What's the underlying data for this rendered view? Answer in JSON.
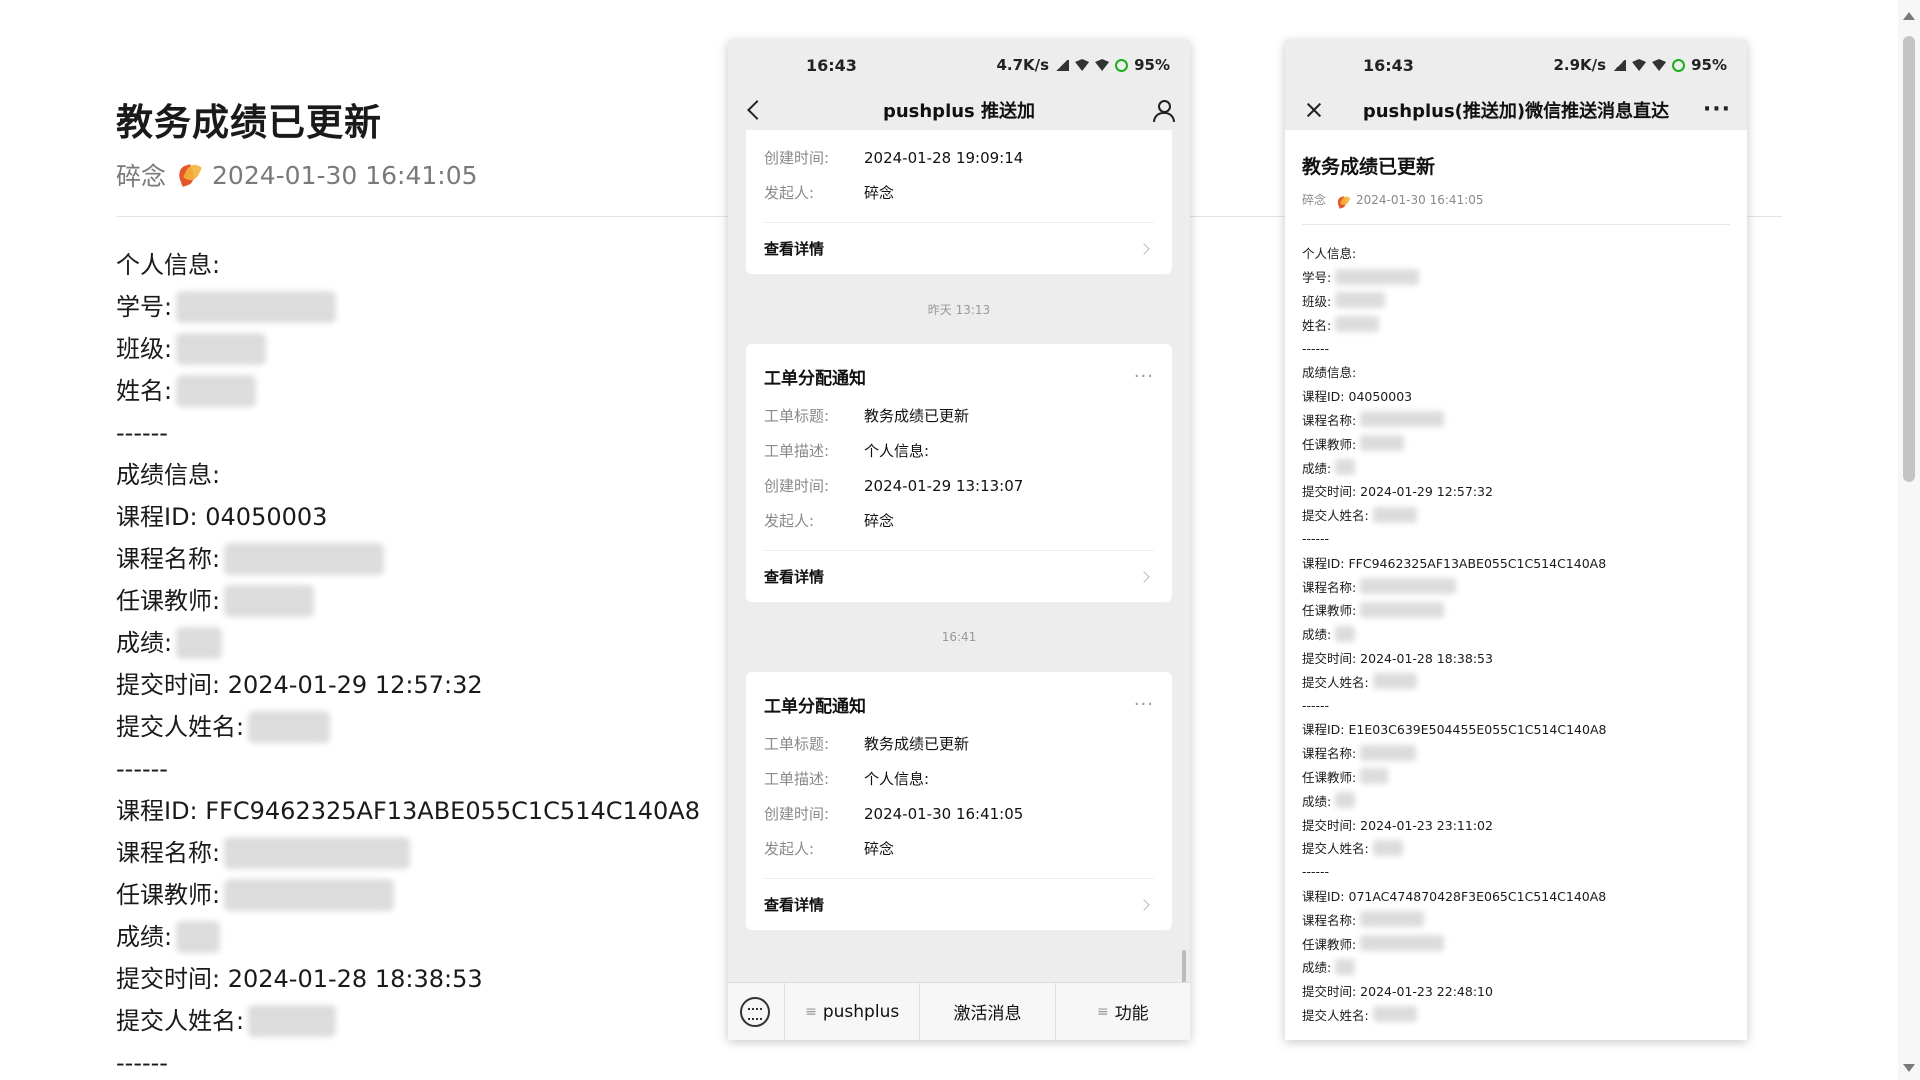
{
  "article": {
    "title": "教务成绩已更新",
    "author": "碎念",
    "datetime": "2024-01-30 16:41:05",
    "lines": [
      {
        "label": "个人信息:",
        "blur": 0
      },
      {
        "label": "学号:",
        "blur": 160
      },
      {
        "label": "班级:",
        "blur": 90
      },
      {
        "label": "姓名:",
        "blur": 80
      },
      {
        "label": "------",
        "blur": 0
      },
      {
        "label": "成绩信息:",
        "blur": 0
      },
      {
        "label": "课程ID: 04050003",
        "blur": 0
      },
      {
        "label": "课程名称:",
        "blur": 160
      },
      {
        "label": "任课教师:",
        "blur": 90
      },
      {
        "label": "成绩:",
        "blur": 46
      },
      {
        "label": "提交时间: 2024-01-29 12:57:32",
        "blur": 0
      },
      {
        "label": "提交人姓名:",
        "blur": 82
      },
      {
        "label": "------",
        "blur": 0
      },
      {
        "label": "课程ID: FFC9462325AF13ABE055C1C514C140A8",
        "blur": 0
      },
      {
        "label": "课程名称:",
        "blur": 186
      },
      {
        "label": "任课教师:",
        "blur": 170
      },
      {
        "label": "成绩:",
        "blur": 44
      },
      {
        "label": "提交时间: 2024-01-28 18:38:53",
        "blur": 0
      },
      {
        "label": "提交人姓名:",
        "blur": 88
      },
      {
        "label": "------",
        "blur": 0
      }
    ]
  },
  "phone1": {
    "time": "16:43",
    "net": "4.7K/s",
    "battery": "95%",
    "nav_title": "pushplus 推送加",
    "partial_card": {
      "rows": [
        {
          "k": "创建时间:",
          "v": "2024-01-28 19:09:14"
        },
        {
          "k": "发起人:",
          "v": "碎念"
        }
      ],
      "detail": "查看详情"
    },
    "time_label_1": "昨天 13:13",
    "card1": {
      "title": "工单分配通知",
      "rows": [
        {
          "k": "工单标题:",
          "v": "教务成绩已更新"
        },
        {
          "k": "工单描述:",
          "v": "个人信息:"
        },
        {
          "k": "创建时间:",
          "v": "2024-01-29 13:13:07"
        },
        {
          "k": "发起人:",
          "v": "碎念"
        }
      ],
      "detail": "查看详情"
    },
    "time_label_2": "16:41",
    "card2": {
      "title": "工单分配通知",
      "rows": [
        {
          "k": "工单标题:",
          "v": "教务成绩已更新"
        },
        {
          "k": "工单描述:",
          "v": "个人信息:"
        },
        {
          "k": "创建时间:",
          "v": "2024-01-30 16:41:05"
        },
        {
          "k": "发起人:",
          "v": "碎念"
        }
      ],
      "detail": "查看详情"
    },
    "menu": [
      "pushplus",
      "激活消息",
      "功能"
    ]
  },
  "phone2": {
    "time": "16:43",
    "net": "2.9K/s",
    "battery": "95%",
    "nav_title": "pushplus(推送加)微信推送消息直达",
    "article_title": "教务成绩已更新",
    "author": "碎念",
    "datetime": "2024-01-30 16:41:05",
    "lines": [
      {
        "label": "个人信息:",
        "blur": 0
      },
      {
        "label": "学号:",
        "blur": 84
      },
      {
        "label": "班级:",
        "blur": 50
      },
      {
        "label": "姓名:",
        "blur": 44
      },
      {
        "label": "------",
        "blur": 0
      },
      {
        "label": "成绩信息:",
        "blur": 0
      },
      {
        "label": "课程ID: 04050003",
        "blur": 0
      },
      {
        "label": "课程名称:",
        "blur": 84
      },
      {
        "label": "任课教师:",
        "blur": 44
      },
      {
        "label": "成绩:",
        "blur": 20
      },
      {
        "label": "提交时间: 2024-01-29 12:57:32",
        "blur": 0
      },
      {
        "label": "提交人姓名:",
        "blur": 44
      },
      {
        "label": "------",
        "blur": 0
      },
      {
        "label": "课程ID: FFC9462325AF13ABE055C1C514C140A8",
        "blur": 0
      },
      {
        "label": "课程名称:",
        "blur": 96
      },
      {
        "label": "任课教师:",
        "blur": 84
      },
      {
        "label": "成绩:",
        "blur": 20
      },
      {
        "label": "提交时间: 2024-01-28 18:38:53",
        "blur": 0
      },
      {
        "label": "提交人姓名:",
        "blur": 44
      },
      {
        "label": "------",
        "blur": 0
      },
      {
        "label": "课程ID: E1E03C639E504455E055C1C514C140A8",
        "blur": 0
      },
      {
        "label": "课程名称:",
        "blur": 56
      },
      {
        "label": "任课教师:",
        "blur": 28
      },
      {
        "label": "成绩:",
        "blur": 20
      },
      {
        "label": "提交时间: 2024-01-23 23:11:02",
        "blur": 0
      },
      {
        "label": "提交人姓名:",
        "blur": 30
      },
      {
        "label": "------",
        "blur": 0
      },
      {
        "label": "课程ID: 071AC474870428F3E065C1C514C140A8",
        "blur": 0
      },
      {
        "label": "课程名称:",
        "blur": 64
      },
      {
        "label": "任课教师:",
        "blur": 84
      },
      {
        "label": "成绩:",
        "blur": 20
      },
      {
        "label": "提交时间: 2024-01-23 22:48:10",
        "blur": 0
      },
      {
        "label": "提交人姓名:",
        "blur": 44
      }
    ]
  }
}
